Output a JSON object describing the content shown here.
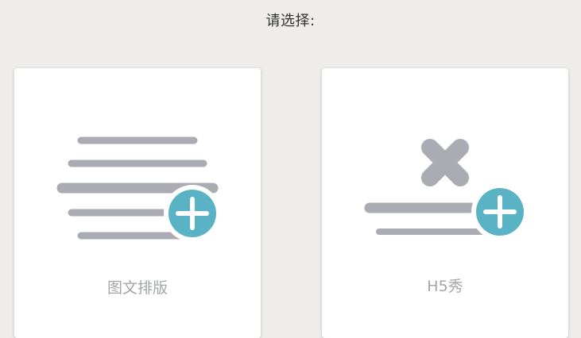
{
  "header": {
    "prompt": "请选择:"
  },
  "options": [
    {
      "label": "图文排版",
      "icon": "text-layout-add-icon"
    },
    {
      "label": "H5秀",
      "icon": "h5-show-add-icon"
    }
  ],
  "colors": {
    "background": "#eeedeb",
    "card": "#ffffff",
    "icon_gray": "#abacb3",
    "plus_accent": "#5ab3c5",
    "label_gray": "#a3a5aa"
  }
}
